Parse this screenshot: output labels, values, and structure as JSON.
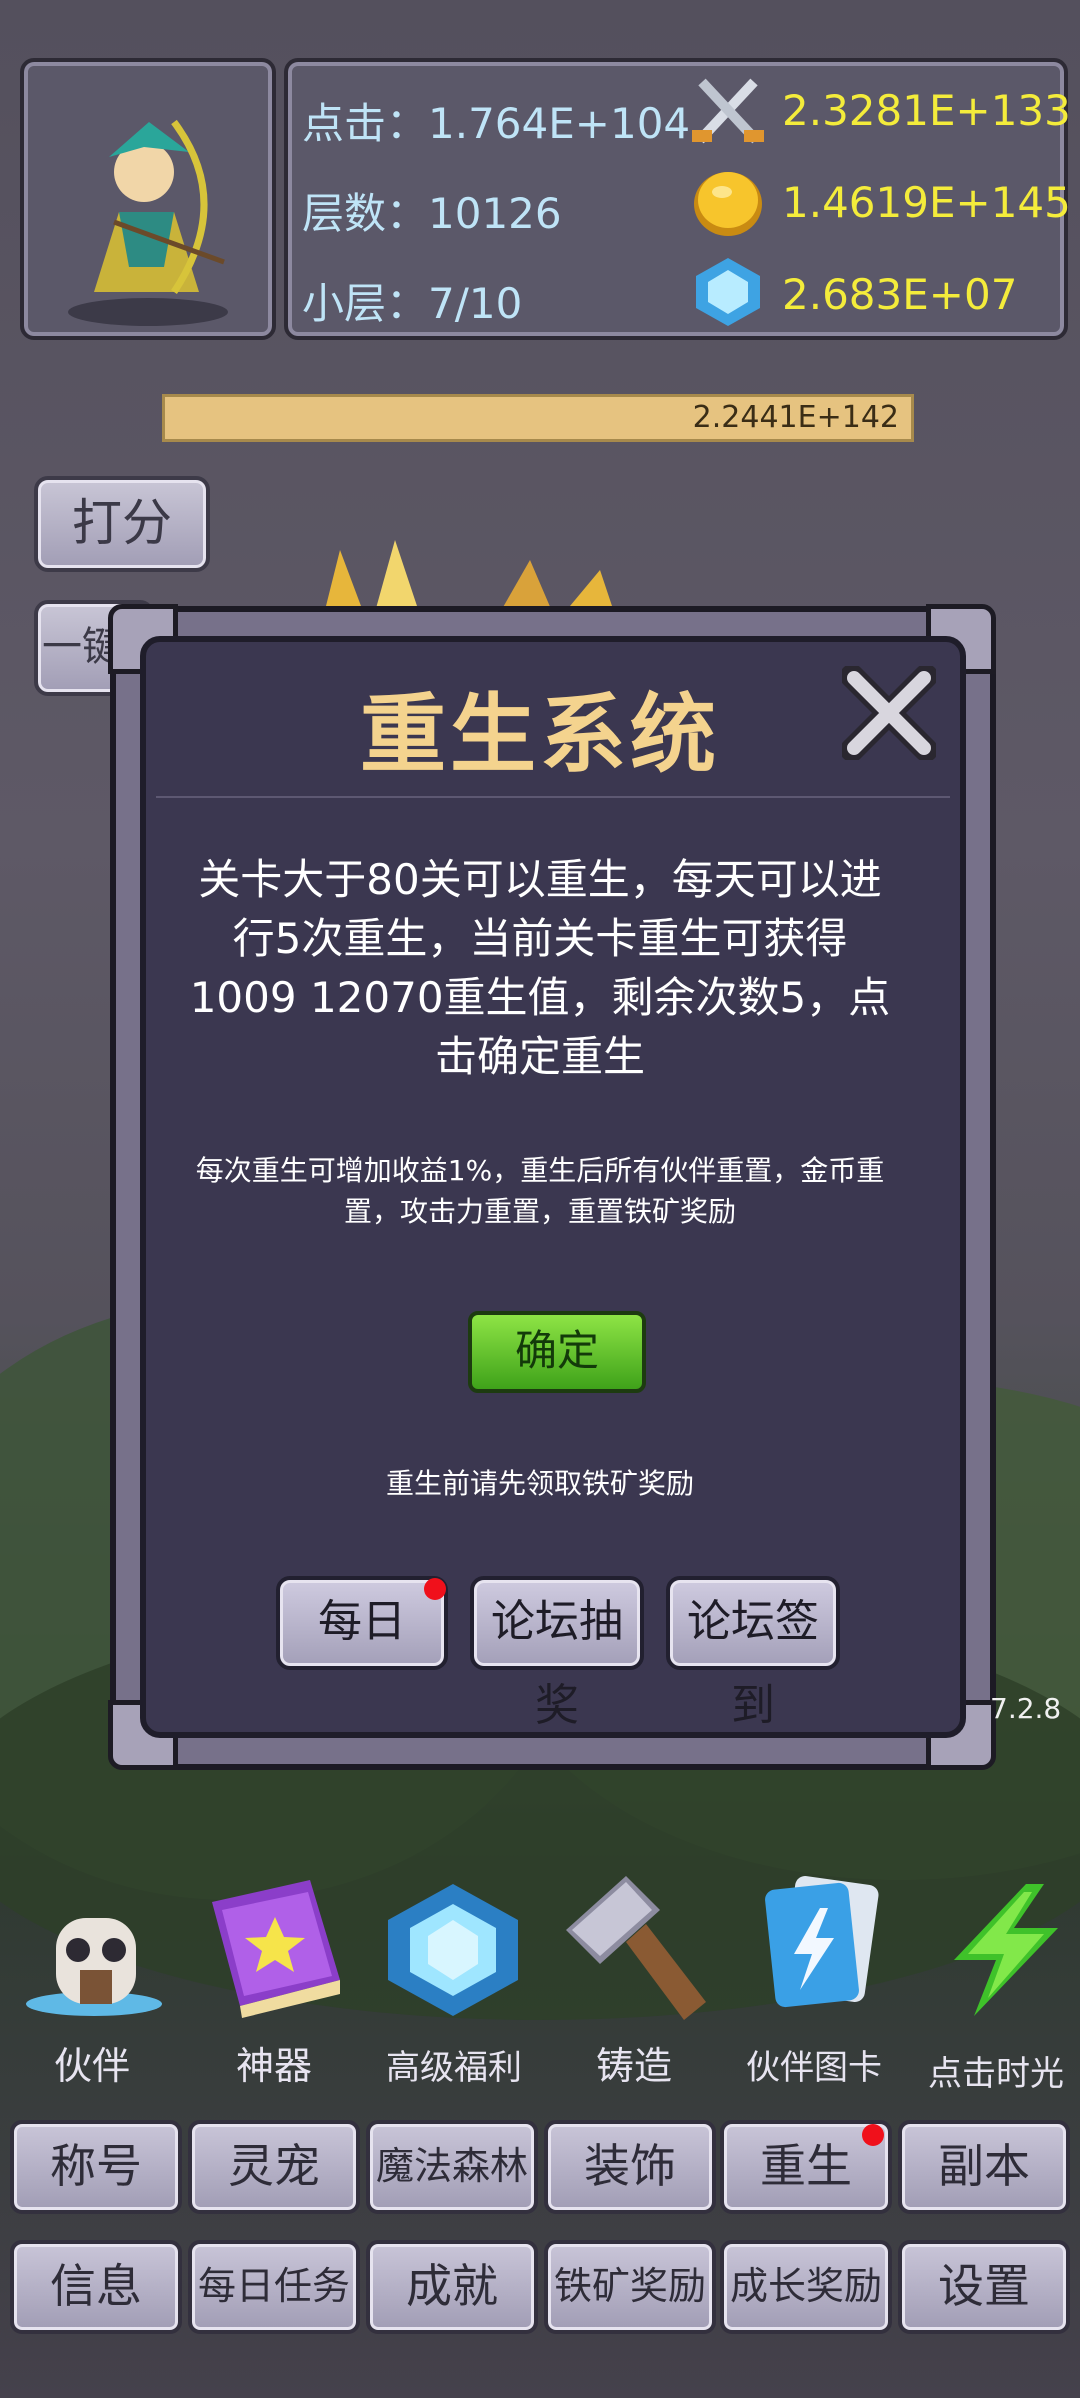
{
  "stats": {
    "click_label": "点击：1.764E+104",
    "floor_label": "层数：10126",
    "sublayer_label": "小层：7/10",
    "attack_value": "2.3281E+133",
    "gold_value": "1.4619E+145",
    "gem_value": "2.683E+07"
  },
  "progress": {
    "text": "2.2441E+142"
  },
  "side": {
    "score_btn": "打分",
    "one_key_btn": "一键"
  },
  "dialog": {
    "title": "重生系统",
    "main_text": "关卡大于80关可以重生，每天可以进行5次重生，当前关卡重生可获得1009 12070重生值，剩余次数5，点击确定重生",
    "sub_text": "每次重生可增加收益1%，重生后所有伙伴重置，金币重置，攻击力重置，重置铁矿奖励",
    "confirm_btn": "确定",
    "notice": "重生前请先领取铁矿奖励",
    "buttons": [
      "每日",
      "论坛抽奖",
      "论坛签到"
    ]
  },
  "version": "7.2.8",
  "bottom_icons": [
    "伙伴",
    "神器",
    "高级福利",
    "铸造",
    "伙伴图卡",
    "点击时光"
  ],
  "grid_row1": [
    "称号",
    "灵宠",
    "魔法森林",
    "装饰",
    "重生",
    "副本"
  ],
  "grid_row2": [
    "信息",
    "每日任务",
    "成就",
    "铁矿奖励",
    "成长奖励",
    "设置"
  ],
  "colors": {
    "accent_yellow": "#f4ec3b",
    "title_gold": "#f4d38e",
    "confirm_green": "#5cc42b",
    "badge_red": "#f0101b"
  },
  "icons": [
    "sword-icon",
    "gold-coin-icon",
    "diamond-icon",
    "close-icon"
  ]
}
